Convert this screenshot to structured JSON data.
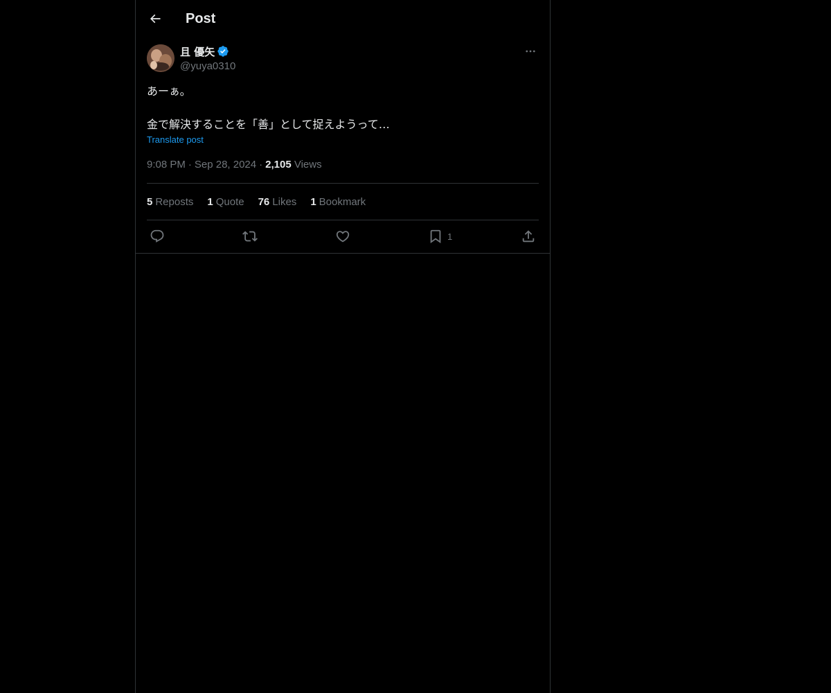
{
  "header": {
    "title": "Post"
  },
  "post": {
    "author_name": "且 優矢",
    "handle": "@yuya0310",
    "text": "あーぁ。\n\n金で解決することを「善」として捉えようって…",
    "translate_label": "Translate post",
    "time": "9:08 PM",
    "date": "Sep 28, 2024",
    "views_count": "2,105",
    "views_label": "Views"
  },
  "stats": {
    "reposts_count": "5",
    "reposts_label": "Reposts",
    "quote_count": "1",
    "quote_label": "Quote",
    "likes_count": "76",
    "likes_label": "Likes",
    "bookmark_count": "1",
    "bookmark_label": "Bookmark"
  },
  "actions": {
    "bookmark_count": "1"
  },
  "icons": {
    "back": "arrow-left-icon",
    "verified": "verified-badge-icon",
    "more": "more-horizontal-icon",
    "reply": "reply-icon",
    "repost": "repost-icon",
    "like": "heart-icon",
    "bookmark": "bookmark-icon",
    "share": "share-icon"
  },
  "colors": {
    "background": "#000000",
    "text_primary": "#e7e9ea",
    "text_secondary": "#71767b",
    "accent": "#1d9bf0",
    "border": "#2f3336"
  }
}
